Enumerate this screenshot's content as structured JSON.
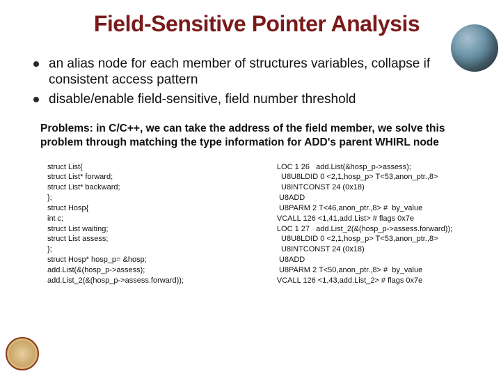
{
  "title": "Field-Sensitive Pointer Analysis",
  "bullets": [
    "an alias node for each member of structures variables, collapse if consistent access pattern",
    "disable/enable field-sensitive, field number threshold"
  ],
  "problems": "Problems: in C/C++, we can take  the address of the field member, we solve this problem through matching the type information for ADD's parent WHIRL node",
  "code_left": "struct List{\nstruct List* forward;\nstruct List* backward;\n};\nstruct Hosp{\nint c;\nstruct List waiting;\nstruct List assess;\n};\nstruct Hosp* hosp_p= &hosp;\nadd.List(&(hosp_p->assess);\nadd.List_2(&(hosp_p->assess.forward));",
  "code_right": "LOC 1 26   add.List(&hosp_p->assess);\n  U8U8LDID 0 <2,1,hosp_p> T<53,anon_ptr.,8>\n  U8INTCONST 24 (0x18)\n U8ADD\n U8PARM 2 T<46,anon_ptr.,8> #  by_value\nVCALL 126 <1,41,add.List> # flags 0x7e\nLOC 1 27   add.List_2(&(hosp_p->assess.forward));\n  U8U8LDID 0 <2,1,hosp_p> T<53,anon_ptr.,8>\n  U8INTCONST 24 (0x18)\n U8ADD\n U8PARM 2 T<50,anon_ptr.,8> #  by_value\nVCALL 126 <1,43,add.List_2> # flags 0x7e"
}
